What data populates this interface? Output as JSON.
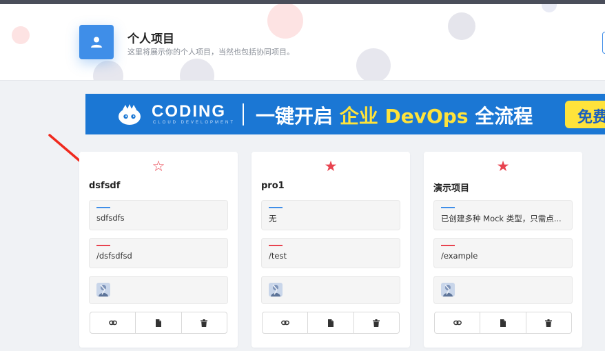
{
  "header": {
    "title": "个人项目",
    "subtitle": "这里将展示你的个人项目，当然也包括协同项目。",
    "icon": "user-icon"
  },
  "banner": {
    "brand": "CODING",
    "brand_sub": "CLOUD DEVELOPMENT",
    "slogan_prefix": "一键开启 ",
    "slogan_highlight": "企业 DevOps",
    "slogan_suffix": " 全流程",
    "cta": "免费",
    "colors": {
      "background": "#1b77d4",
      "highlight": "#ffe33b"
    }
  },
  "projects": [
    {
      "name": "dsfsdf",
      "description": "sdfsdfs",
      "url": "/dsfsdfsd",
      "starred": false,
      "star_glyph": "☆"
    },
    {
      "name": "pro1",
      "description": "无",
      "url": "/test",
      "starred": true,
      "star_glyph": "★"
    },
    {
      "name": "演示项目",
      "description": "已创建多种 Mock 类型，只需点...",
      "url": "/example",
      "starred": true,
      "star_glyph": "★"
    }
  ],
  "card_actions": [
    "link-icon",
    "copy-icon",
    "trash-icon"
  ],
  "colors": {
    "accent": "#3f8ee8",
    "star": "#e8434f",
    "page_bg": "#f0f2f5"
  }
}
